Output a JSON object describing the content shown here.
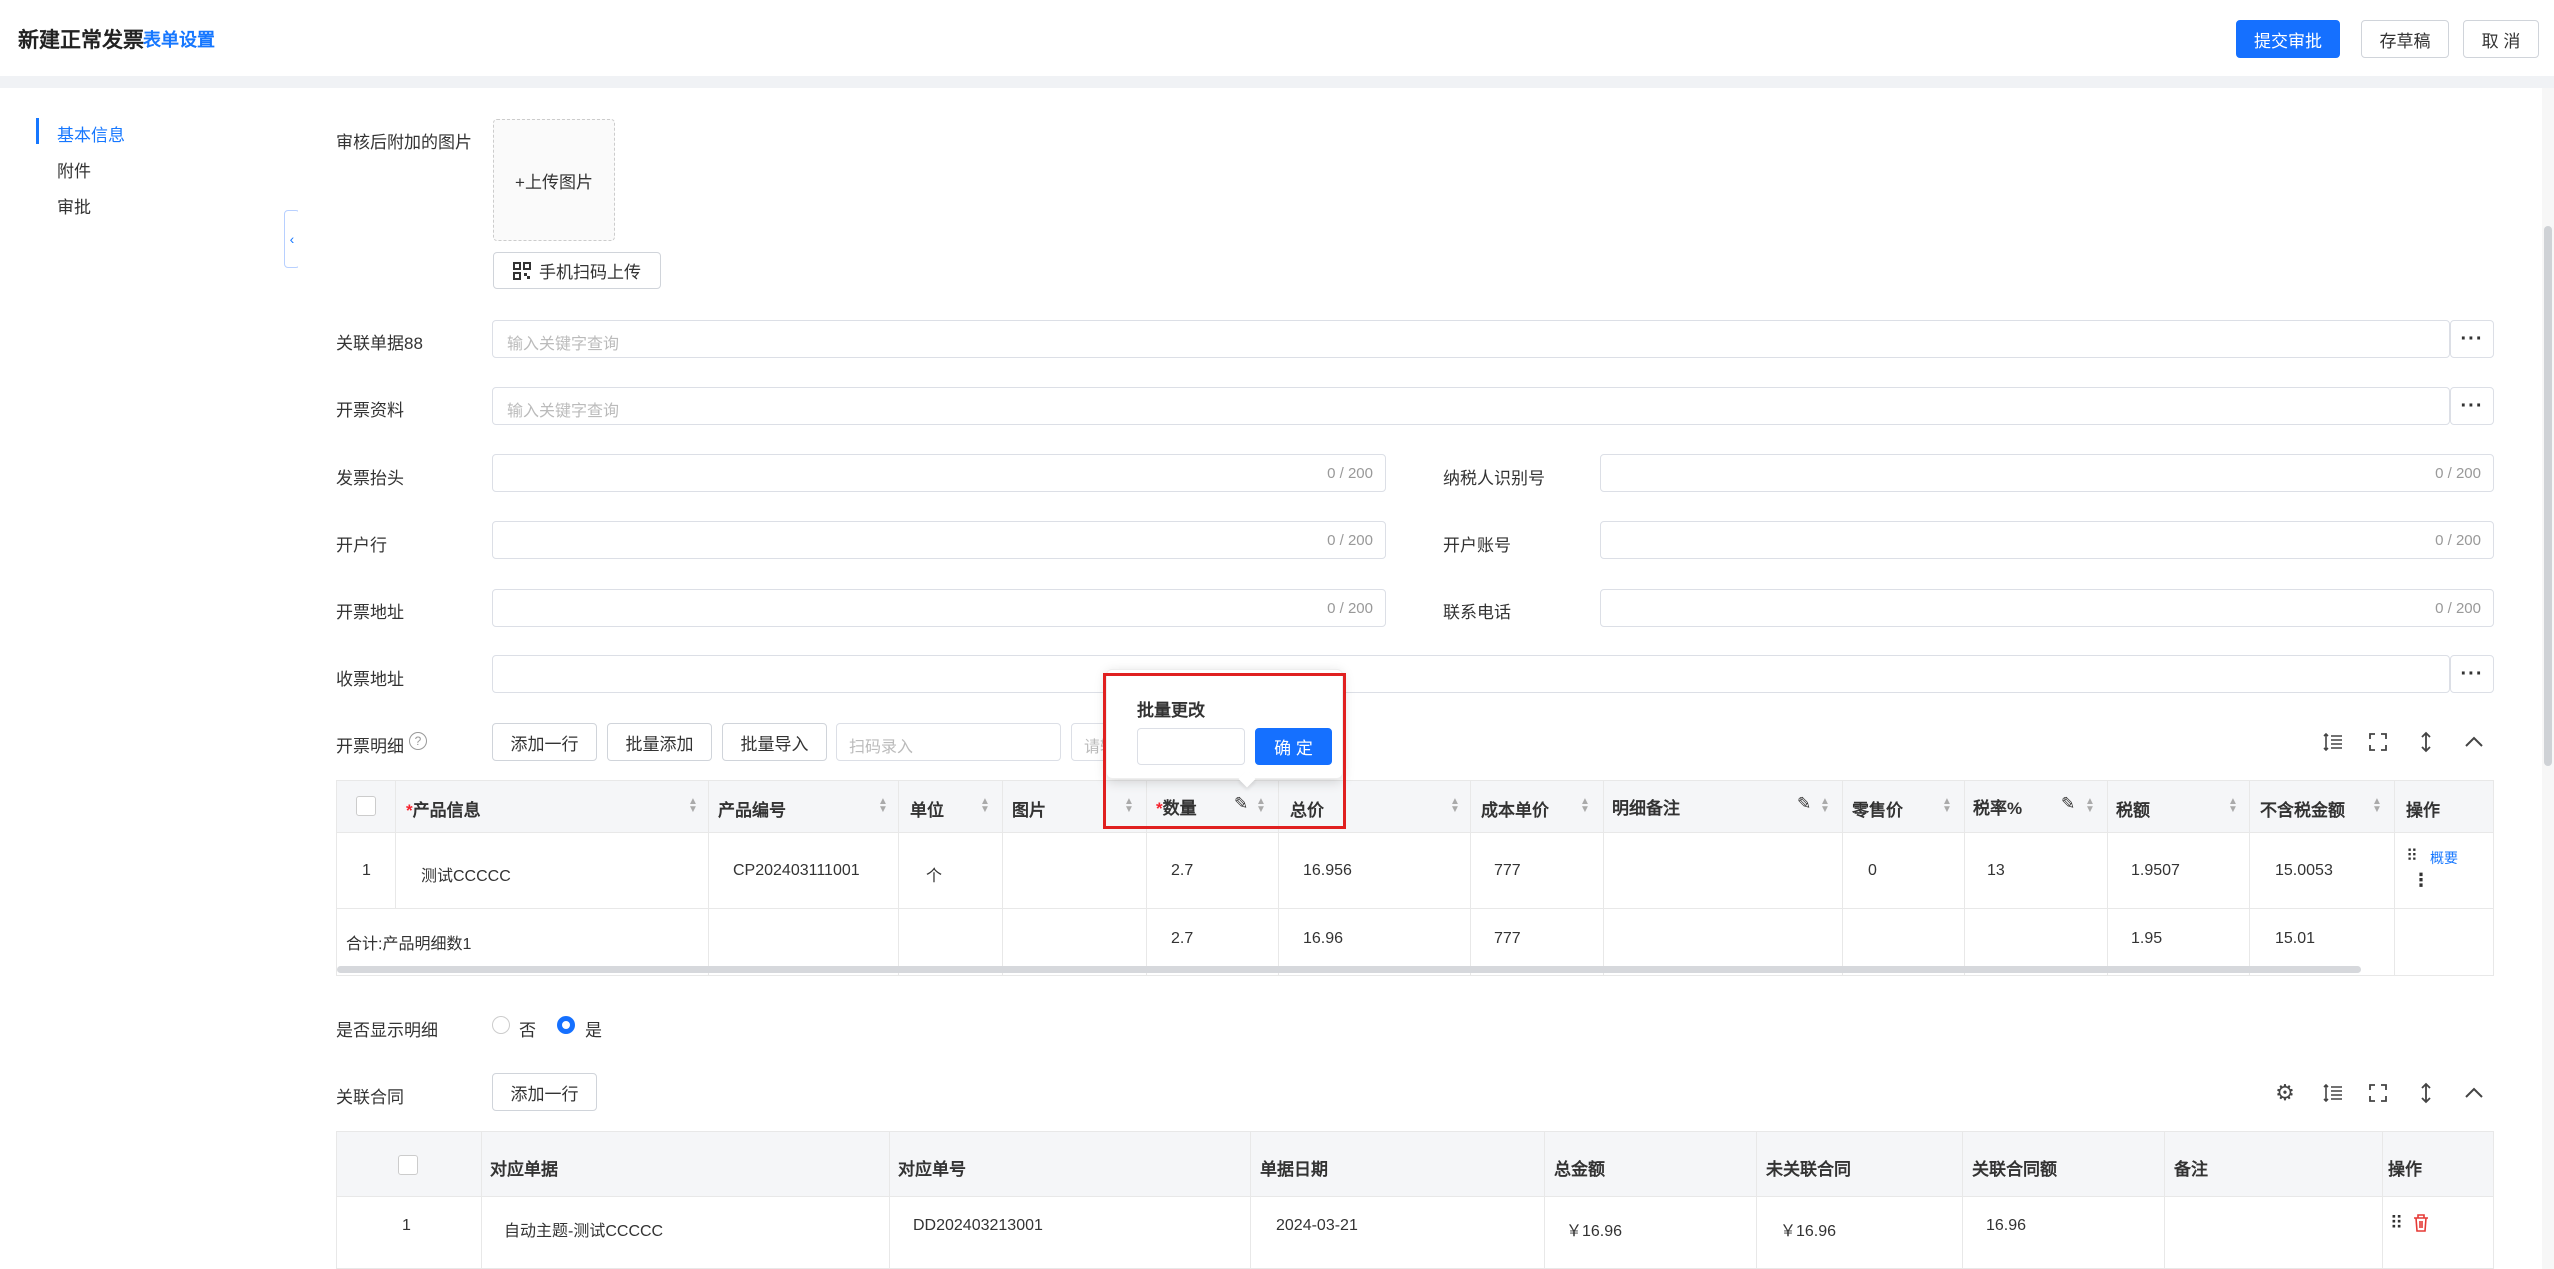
{
  "header": {
    "title": "新建正常发票",
    "form_settings": "表单设置",
    "submit": "提交审批",
    "save_draft": "存草稿",
    "cancel": "取 消"
  },
  "nav": {
    "items": [
      {
        "label": "基本信息"
      },
      {
        "label": "附件"
      },
      {
        "label": "审批"
      }
    ]
  },
  "collapse_icon": "‹",
  "upload": {
    "label": "审核后附加的图片",
    "upload_text": "+上传图片",
    "scan_button": "手机扫码上传"
  },
  "fields": {
    "related_doc": {
      "label": "关联单据88",
      "placeholder": "输入关键字查询"
    },
    "invoice_info": {
      "label": "开票资料",
      "placeholder": "输入关键字查询"
    },
    "invoice_title": {
      "label": "发票抬头",
      "counter": "0 / 200"
    },
    "taxpayer_id": {
      "label": "纳税人识别号",
      "counter": "0 / 200"
    },
    "bank": {
      "label": "开户行",
      "counter": "0 / 200"
    },
    "account": {
      "label": "开户账号",
      "counter": "0 / 200"
    },
    "address": {
      "label": "开票地址",
      "counter": "0 / 200"
    },
    "phone": {
      "label": "联系电话",
      "counter": "0 / 200"
    },
    "receive_address": {
      "label": "收票地址"
    },
    "more": "···"
  },
  "details": {
    "label": "开票明细",
    "help_icon": "?",
    "buttons": {
      "add_row": "添加一行",
      "batch_add": "批量添加",
      "batch_import": "批量导入"
    },
    "scan_placeholder": "扫码录入",
    "clipped_placeholder": "请输入",
    "columns": [
      "产品信息",
      "产品编号",
      "单位",
      "图片",
      "数量",
      "总价",
      "成本单价",
      "明细备注",
      "零售价",
      "税率%",
      "税额",
      "不含税金额",
      "操作"
    ],
    "row": {
      "index": "1",
      "product": "测试CCCCC",
      "code": "CP202403111001",
      "unit": "个",
      "image": "",
      "qty": "2.7",
      "total": "16.956",
      "cost": "777",
      "note": "",
      "retail": "0",
      "tax_rate": "13",
      "tax": "1.9507",
      "ex_tax": "15.0053",
      "op": "概要"
    },
    "summary": {
      "label": "合计:",
      "count_text": "产品明细数1",
      "qty": "2.7",
      "total": "16.96",
      "cost": "777",
      "tax": "1.95",
      "ex_tax": "15.01"
    }
  },
  "popover": {
    "title": "批量更改",
    "confirm": "确 定"
  },
  "show_detail": {
    "label": "是否显示明细",
    "no": "否",
    "yes": "是",
    "selected": "是"
  },
  "contracts": {
    "label": "关联合同",
    "add_row": "添加一行",
    "columns": [
      "对应单据",
      "对应单号",
      "单据日期",
      "总金额",
      "未关联合同",
      "关联合同额",
      "备注",
      "操作"
    ],
    "row": {
      "index": "1",
      "doc": "自动主题-测试CCCCC",
      "doc_no": "DD202403213001",
      "date": "2024-03-21",
      "total": "￥16.96",
      "unlinked": "￥16.96",
      "linked": "16.96",
      "note": ""
    }
  },
  "colors": {
    "primary": "#1570ff",
    "highlight_border": "#e02020",
    "required": "#f5222d"
  }
}
